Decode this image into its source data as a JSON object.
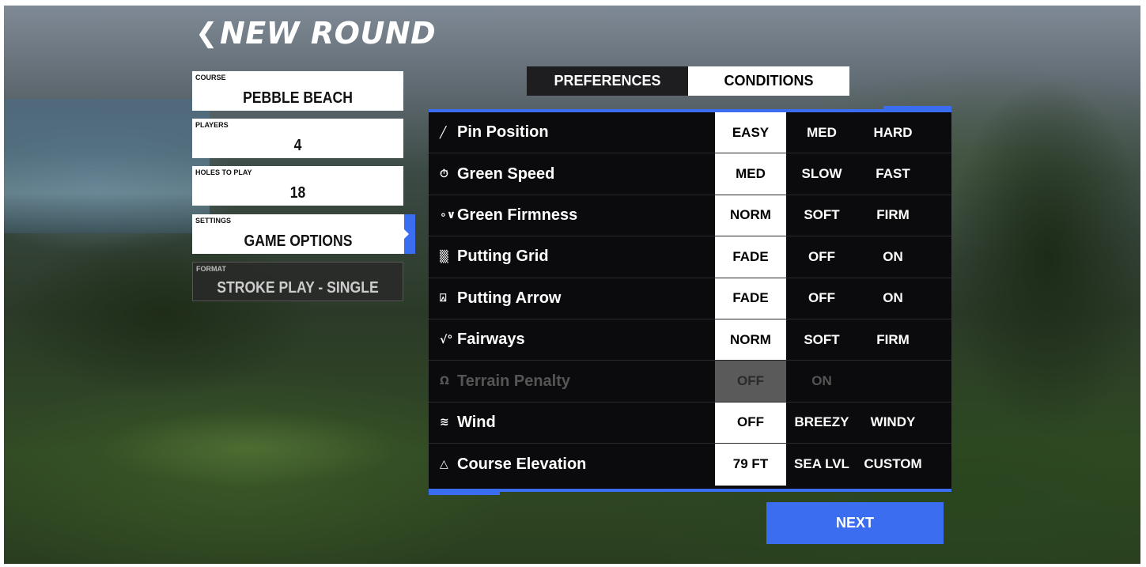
{
  "header": {
    "title": "NEW ROUND",
    "back_icon": "chevron-left-icon"
  },
  "fields": [
    {
      "label": "COURSE",
      "value": "PEBBLE BEACH"
    },
    {
      "label": "PLAYERS",
      "value": "4"
    },
    {
      "label": "HOLES TO PLAY",
      "value": "18"
    },
    {
      "label": "SETTINGS",
      "value": "GAME OPTIONS"
    },
    {
      "label": "FORMAT",
      "value": "STROKE PLAY - SINGLE"
    }
  ],
  "tabs": [
    {
      "label": "PREFERENCES",
      "active": false
    },
    {
      "label": "CONDITIONS",
      "active": true
    }
  ],
  "conditions": [
    {
      "name": "Pin Position",
      "icon": "flag-icon",
      "options": [
        "EASY",
        "MED",
        "HARD"
      ],
      "selected": "EASY",
      "enabled": true
    },
    {
      "name": "Green Speed",
      "icon": "stopwatch-icon",
      "options": [
        "MED",
        "SLOW",
        "FAST"
      ],
      "selected": "MED",
      "enabled": true
    },
    {
      "name": "Green Firmness",
      "icon": "firmness-icon",
      "options": [
        "NORM",
        "SOFT",
        "FIRM"
      ],
      "selected": "NORM",
      "enabled": true
    },
    {
      "name": "Putting Grid",
      "icon": "grid-icon",
      "options": [
        "FADE",
        "OFF",
        "ON"
      ],
      "selected": "FADE",
      "enabled": true
    },
    {
      "name": "Putting Arrow",
      "icon": "putting-arrow-icon",
      "options": [
        "FADE",
        "OFF",
        "ON"
      ],
      "selected": "FADE",
      "enabled": true
    },
    {
      "name": "Fairways",
      "icon": "fairway-icon",
      "options": [
        "NORM",
        "SOFT",
        "FIRM"
      ],
      "selected": "NORM",
      "enabled": true
    },
    {
      "name": "Terrain Penalty",
      "icon": "terrain-icon",
      "options": [
        "OFF",
        "ON"
      ],
      "selected": "OFF",
      "enabled": false
    },
    {
      "name": "Wind",
      "icon": "wind-icon",
      "options": [
        "OFF",
        "BREEZY",
        "WINDY"
      ],
      "selected": "OFF",
      "enabled": true
    },
    {
      "name": "Course Elevation",
      "icon": "mountain-icon",
      "options": [
        "79 FT",
        "SEA LVL",
        "CUSTOM"
      ],
      "selected": "79 FT",
      "enabled": true
    }
  ],
  "next_label": "NEXT",
  "colors": {
    "accent": "#3a6df0",
    "panel_bg": "#0b0b0d",
    "selected_bg": "#ffffff"
  }
}
